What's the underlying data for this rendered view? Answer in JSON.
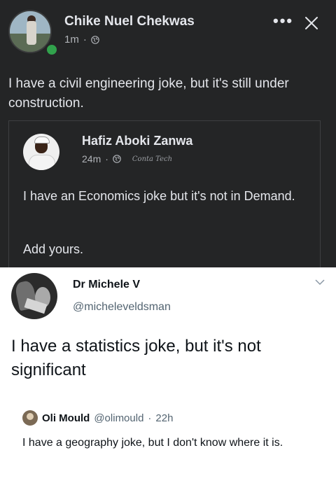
{
  "facebook_post": {
    "author": "Chike Nuel Chekwas",
    "time": "1m",
    "meta_separator": "·",
    "text": "I have a civil engineering joke, but it's still under construction.",
    "shared_post": {
      "author": "Hafiz Aboki Zanwa",
      "time": "24m",
      "meta_separator": "·",
      "watermark": "Conta Tech",
      "text": "I have an Economics joke but it's not in Demand.",
      "add_yours": "Add yours."
    },
    "colors": {
      "background": "#242526",
      "text": "#e4e6eb",
      "meta": "#b0b3b8",
      "online": "#31a24c"
    }
  },
  "tweet": {
    "author": "Dr Michele V",
    "handle": "@micheleveldsman",
    "text": "I have a statistics joke, but it's not significant",
    "quoted": {
      "author": "Oli Mould",
      "handle": "@olimould",
      "separator": "·",
      "time": "22h",
      "text": "I have a geography joke, but I don't know where it is."
    },
    "colors": {
      "text": "#0f1419",
      "secondary": "#536471"
    }
  }
}
